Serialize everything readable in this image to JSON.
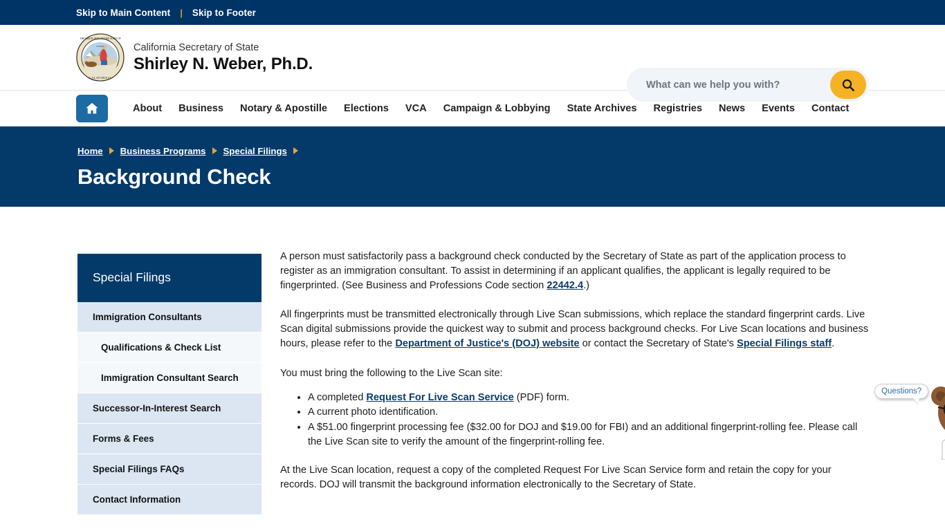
{
  "skip": {
    "main_content": "Skip to Main Content",
    "separator": "|",
    "footer": "Skip to Footer"
  },
  "header": {
    "seal_alt": "Great Seal of the State of California",
    "org": "California Secretary of State",
    "official_name": "Shirley N. Weber, Ph.D.",
    "search": {
      "placeholder": "What can we help you with?",
      "value": "",
      "button_icon": "search-icon",
      "button_color": "#f5b225"
    }
  },
  "nav": {
    "home_icon": "home-icon",
    "home_color": "#1d6ba4",
    "items": [
      {
        "label": "About"
      },
      {
        "label": "Business"
      },
      {
        "label": "Notary & Apostille"
      },
      {
        "label": "Elections"
      },
      {
        "label": "VCA"
      },
      {
        "label": "Campaign & Lobbying"
      },
      {
        "label": "State Archives"
      },
      {
        "label": "Registries"
      },
      {
        "label": "News"
      },
      {
        "label": "Events"
      },
      {
        "label": "Contact"
      }
    ]
  },
  "hero": {
    "background": "#033a6a",
    "breadcrumbs": [
      {
        "label": "Home"
      },
      {
        "label": "Business Programs"
      },
      {
        "label": "Special Filings"
      }
    ],
    "title": "Background Check"
  },
  "sidebar": {
    "heading": "Special Filings",
    "items": [
      {
        "label": "Immigration Consultants",
        "level": 1
      },
      {
        "label": "Qualifications & Check List",
        "level": 2
      },
      {
        "label": "Immigration Consultant Search",
        "level": 2
      },
      {
        "label": "Successor-In-Interest Search",
        "level": 1
      },
      {
        "label": "Forms & Fees",
        "level": 1
      },
      {
        "label": "Special Filings FAQs",
        "level": 1
      },
      {
        "label": "Contact Information",
        "level": 1
      }
    ]
  },
  "content": {
    "p1_a": "A person must satisfactorily pass a background check conducted by the Secretary of State as part of the application process to register as an immigration consultant. To assist in determining if an applicant qualifies, the applicant is legally required to be fingerprinted. (See Business and Professions Code section ",
    "p1_link": "22442.4",
    "p1_b": ".)",
    "p2_a": "All fingerprints must be transmitted electronically through Live Scan submissions, which replace the standard fingerprint cards. Live Scan digital submissions provide the quickest way to submit and process background checks. For Live Scan locations and business hours, please refer to the ",
    "p2_link1": "Department of Justice's (DOJ) website",
    "p2_b": " or contact the Secretary of State's ",
    "p2_link2": "Special Filings staff",
    "p2_c": ".",
    "p3": "You must bring the following to the Live Scan site:",
    "li1_a": "A completed ",
    "li1_link": "Request For Live Scan Service",
    "li1_b": " (PDF) form.",
    "li2": "A current photo identification.",
    "li3": "A $51.00 fingerprint processing fee ($32.00 for DOJ and $19.00 for FBI) and an additional fingerprint-rolling fee. Please call the Live Scan site to verify the amount of the fingerprint-rolling fee.",
    "p4": "At the Live Scan location, request a copy of the completed Request For Live Scan Service form and retain the copy for your records. DOJ will transmit the background information electronically to the Secretary of State."
  },
  "chat": {
    "bubble_text": "Questions?",
    "avatar": "bear-avatar"
  }
}
